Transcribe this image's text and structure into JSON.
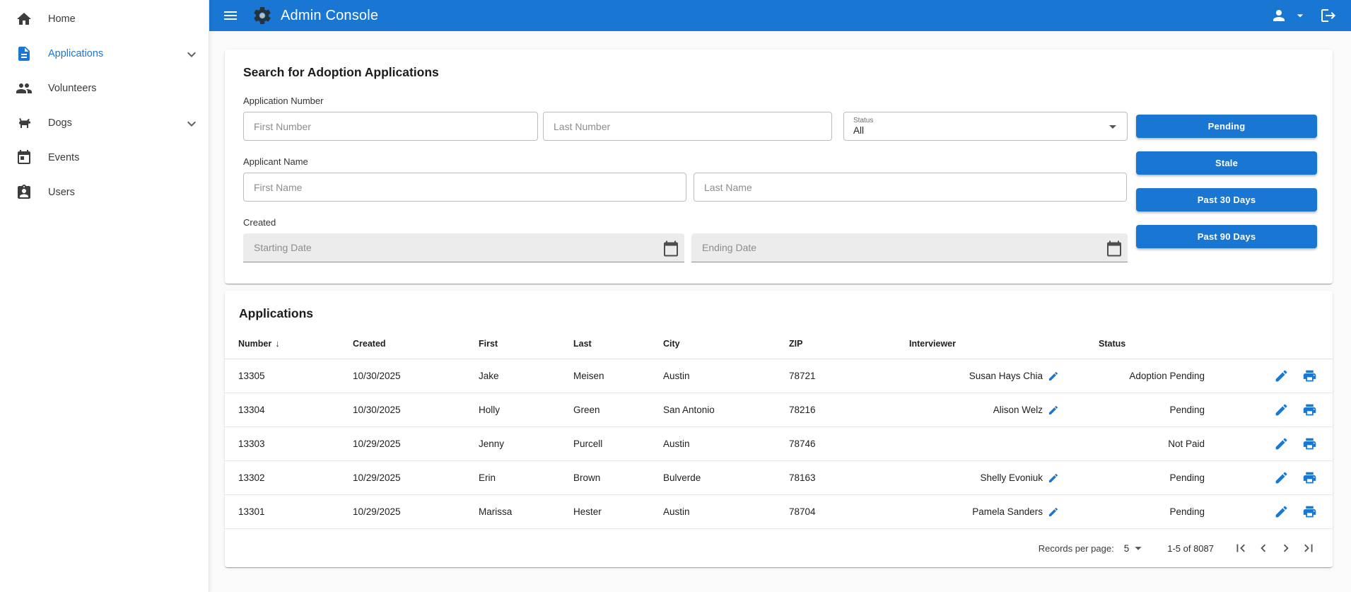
{
  "header": {
    "title": "Admin Console"
  },
  "sidebar": {
    "items": [
      {
        "label": "Home"
      },
      {
        "label": "Applications"
      },
      {
        "label": "Volunteers"
      },
      {
        "label": "Dogs"
      },
      {
        "label": "Events"
      },
      {
        "label": "Users"
      }
    ]
  },
  "search": {
    "title": "Search for Adoption Applications",
    "application_number": {
      "label": "Application Number",
      "first_placeholder": "First Number",
      "last_placeholder": "Last Number"
    },
    "status": {
      "label": "Status",
      "value": "All"
    },
    "applicant_name": {
      "label": "Applicant Name",
      "first_placeholder": "First Name",
      "last_placeholder": "Last Name"
    },
    "created": {
      "label": "Created",
      "start_placeholder": "Starting Date",
      "end_placeholder": "Ending Date"
    },
    "quick_filters": {
      "pending": "Pending",
      "stale": "Stale",
      "past30": "Past 30 Days",
      "past90": "Past 90 Days"
    }
  },
  "applications": {
    "title": "Applications",
    "columns": {
      "number": "Number",
      "created": "Created",
      "first": "First",
      "last": "Last",
      "city": "City",
      "zip": "ZIP",
      "interviewer": "Interviewer",
      "status": "Status"
    },
    "rows": [
      {
        "number": "13305",
        "created": "10/30/2025",
        "first": "Jake",
        "last": "Meisen",
        "city": "Austin",
        "zip": "78721",
        "interviewer": "Susan Hays Chia",
        "status": "Adoption Pending"
      },
      {
        "number": "13304",
        "created": "10/30/2025",
        "first": "Holly",
        "last": "Green",
        "city": "San Antonio",
        "zip": "78216",
        "interviewer": "Alison Welz",
        "status": "Pending"
      },
      {
        "number": "13303",
        "created": "10/29/2025",
        "first": "Jenny",
        "last": "Purcell",
        "city": "Austin",
        "zip": "78746",
        "interviewer": "",
        "status": "Not Paid"
      },
      {
        "number": "13302",
        "created": "10/29/2025",
        "first": "Erin",
        "last": "Brown",
        "city": "Bulverde",
        "zip": "78163",
        "interviewer": "Shelly Evoniuk",
        "status": "Pending"
      },
      {
        "number": "13301",
        "created": "10/29/2025",
        "first": "Marissa",
        "last": "Hester",
        "city": "Austin",
        "zip": "78704",
        "interviewer": "Pamela Sanders",
        "status": "Pending"
      }
    ],
    "pagination": {
      "records_per_page_label": "Records per page:",
      "records_per_page_value": "5",
      "range": "1-5 of 8087"
    }
  },
  "colors": {
    "primary": "#1976d2"
  }
}
